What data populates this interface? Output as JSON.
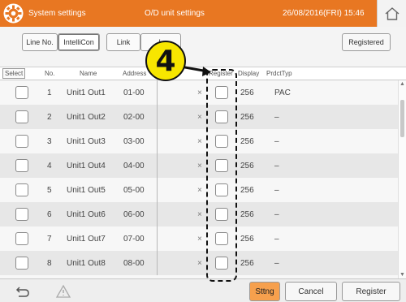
{
  "header": {
    "title": "System settings",
    "subtitle": "O/D unit settings",
    "datetime": "26/08/2016(FRI) 15:46"
  },
  "toolbar": {
    "tabs": [
      "Line No.",
      "IntelliCon",
      "Link",
      "L"
    ],
    "registered_label": "Registered"
  },
  "columns": {
    "select": "Select",
    "no": "No.",
    "name": "Name",
    "address": "Address",
    "register": "Register",
    "display": "Display",
    "prdct_typ": "PrdctTyp"
  },
  "rows": [
    {
      "no": "1",
      "name": "Unit1 Out1",
      "address": "01-00",
      "x": "×",
      "display": "256",
      "prdct": "PAC"
    },
    {
      "no": "2",
      "name": "Unit1 Out2",
      "address": "02-00",
      "x": "×",
      "display": "256",
      "prdct": "–"
    },
    {
      "no": "3",
      "name": "Unit1 Out3",
      "address": "03-00",
      "x": "×",
      "display": "256",
      "prdct": "–"
    },
    {
      "no": "4",
      "name": "Unit1 Out4",
      "address": "04-00",
      "x": "×",
      "display": "256",
      "prdct": "–"
    },
    {
      "no": "5",
      "name": "Unit1 Out5",
      "address": "05-00",
      "x": "×",
      "display": "256",
      "prdct": "–"
    },
    {
      "no": "6",
      "name": "Unit1 Out6",
      "address": "06-00",
      "x": "×",
      "display": "256",
      "prdct": "–"
    },
    {
      "no": "7",
      "name": "Unit1 Out7",
      "address": "07-00",
      "x": "×",
      "display": "256",
      "prdct": "–"
    },
    {
      "no": "8",
      "name": "Unit1 Out8",
      "address": "08-00",
      "x": "×",
      "display": "256",
      "prdct": "–"
    }
  ],
  "footer": {
    "sttng": "Sttng",
    "cancel": "Cancel",
    "register": "Register"
  },
  "annotation": {
    "step": "4"
  },
  "colors": {
    "header": "#e87722",
    "sttng": "#f6a04d",
    "badge": "#f7e600"
  },
  "icons": [
    "gear-icon",
    "home-icon",
    "back-icon",
    "warning-icon"
  ]
}
